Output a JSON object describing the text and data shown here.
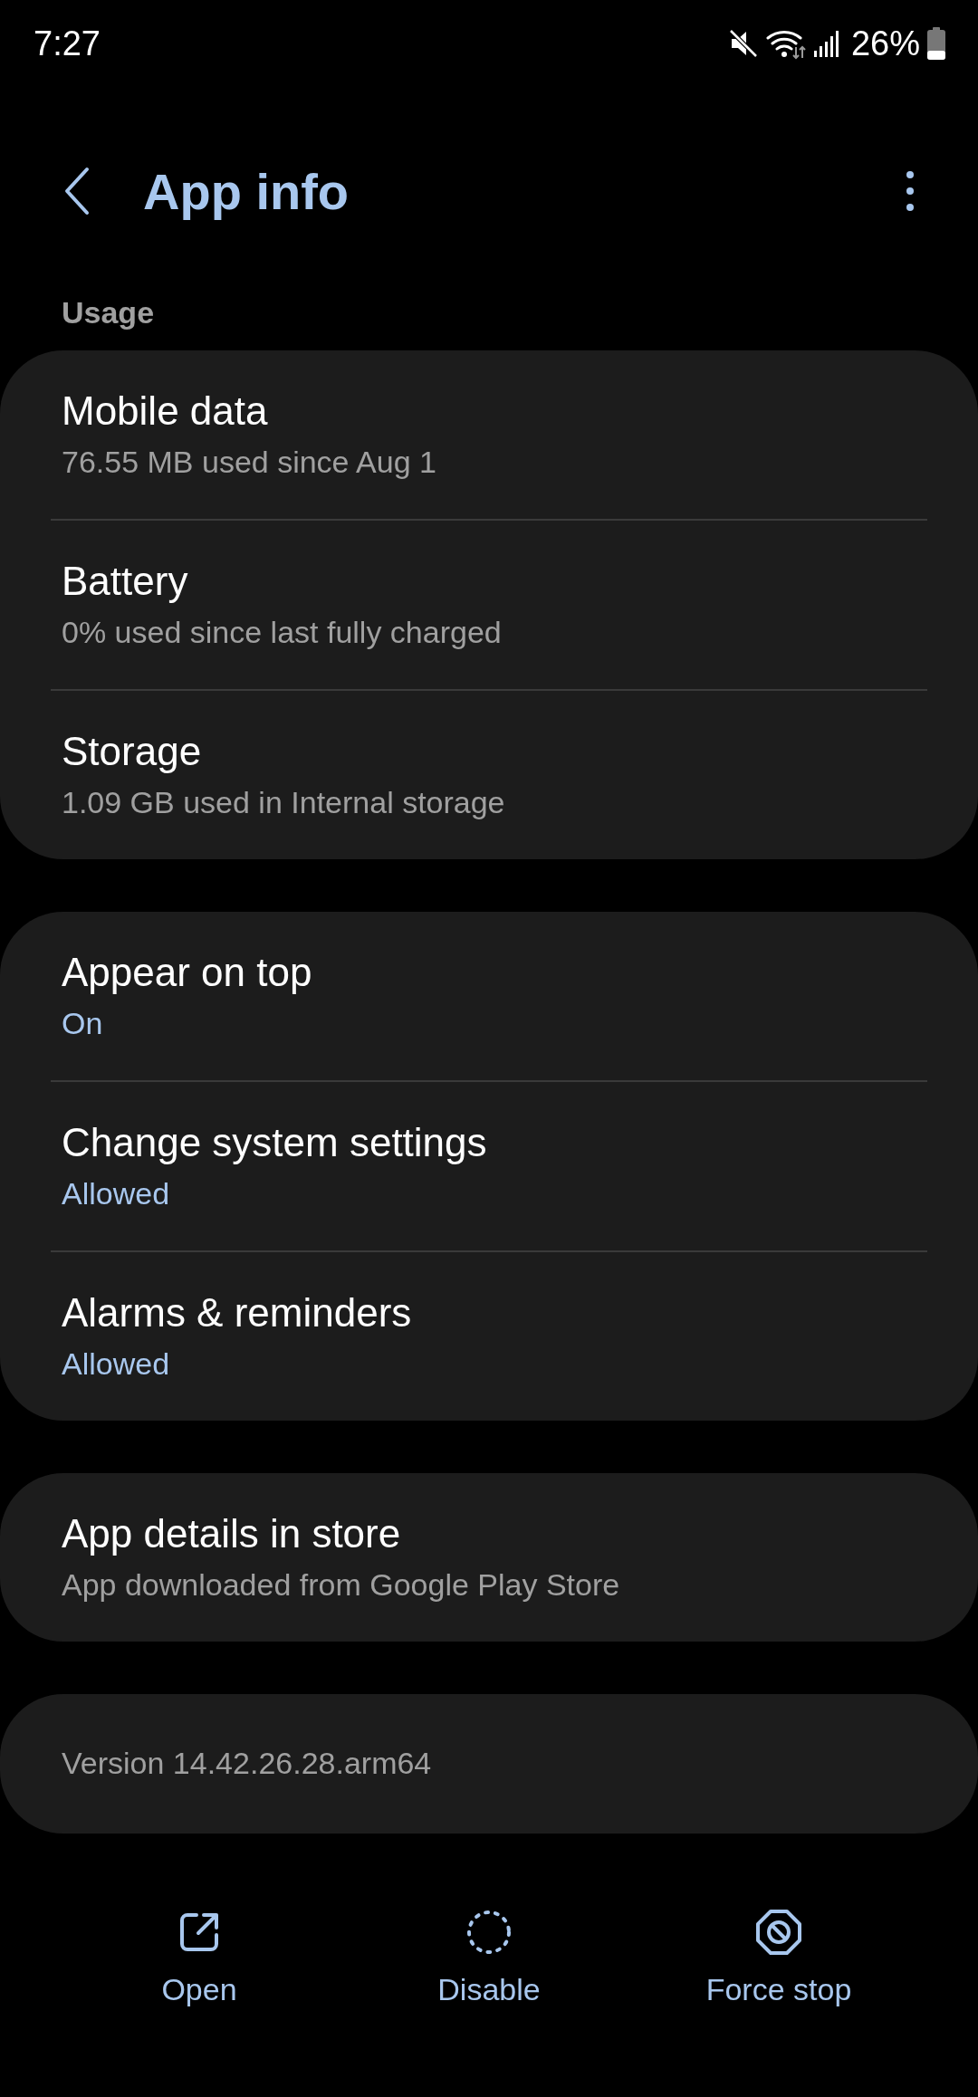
{
  "status_bar": {
    "time": "7:27",
    "battery_text": "26%"
  },
  "header": {
    "title": "App info"
  },
  "section_label": "Usage",
  "groups": [
    {
      "rows": [
        {
          "kind": "summary",
          "title": "Mobile data",
          "subtitle": "76.55 MB used since Aug 1"
        },
        {
          "kind": "summary",
          "title": "Battery",
          "subtitle": "0% used since last fully charged"
        },
        {
          "kind": "summary",
          "title": "Storage",
          "subtitle": "1.09 GB used in Internal storage"
        }
      ]
    },
    {
      "rows": [
        {
          "kind": "permission",
          "title": "Appear on top",
          "subtitle": "On"
        },
        {
          "kind": "permission",
          "title": "Change system settings",
          "subtitle": "Allowed"
        },
        {
          "kind": "permission",
          "title": "Alarms & reminders",
          "subtitle": "Allowed"
        }
      ]
    },
    {
      "rows": [
        {
          "kind": "summary",
          "title": "App details in store",
          "subtitle": "App downloaded from Google Play Store"
        }
      ]
    }
  ],
  "version": "Version 14.42.26.28.arm64",
  "actions": [
    {
      "kind": "open",
      "label": "Open"
    },
    {
      "kind": "disable",
      "label": "Disable"
    },
    {
      "kind": "force_stop",
      "label": "Force stop"
    }
  ]
}
